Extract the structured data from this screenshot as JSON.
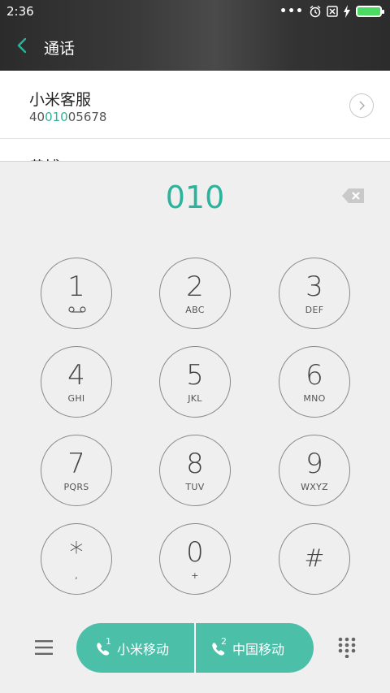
{
  "status_bar": {
    "time": "2:36",
    "overflow": "•••"
  },
  "header": {
    "title": "通话"
  },
  "results": [
    {
      "name": "小米客服",
      "number_prefix": "40",
      "number_match": "010",
      "number_suffix": "05678"
    },
    {
      "name": "黄博"
    }
  ],
  "dialer": {
    "input_value": "010",
    "keys": [
      {
        "digit": "1",
        "letters": ""
      },
      {
        "digit": "2",
        "letters": "ABC"
      },
      {
        "digit": "3",
        "letters": "DEF"
      },
      {
        "digit": "4",
        "letters": "GHI"
      },
      {
        "digit": "5",
        "letters": "JKL"
      },
      {
        "digit": "6",
        "letters": "MNO"
      },
      {
        "digit": "7",
        "letters": "PQRS"
      },
      {
        "digit": "8",
        "letters": "TUV"
      },
      {
        "digit": "9",
        "letters": "WXYZ"
      },
      {
        "digit": "*",
        "letters": ","
      },
      {
        "digit": "0",
        "letters": "+"
      },
      {
        "digit": "#",
        "letters": ""
      }
    ]
  },
  "call_bar": {
    "sim1_label": "小米移动",
    "sim1_index": "1",
    "sim2_label": "中国移动",
    "sim2_index": "2"
  },
  "colors": {
    "accent": "#2bb39b",
    "call_button": "#4cbfa9",
    "header_bg": "#333333"
  },
  "icons": [
    "back-arrow-icon",
    "alarm-icon",
    "sim-x-icon",
    "charging-icon",
    "battery-icon",
    "chevron-right-icon",
    "backspace-icon",
    "voicemail-icon",
    "menu-icon",
    "phone-sim1-icon",
    "phone-sim2-icon",
    "keypad-icon"
  ]
}
